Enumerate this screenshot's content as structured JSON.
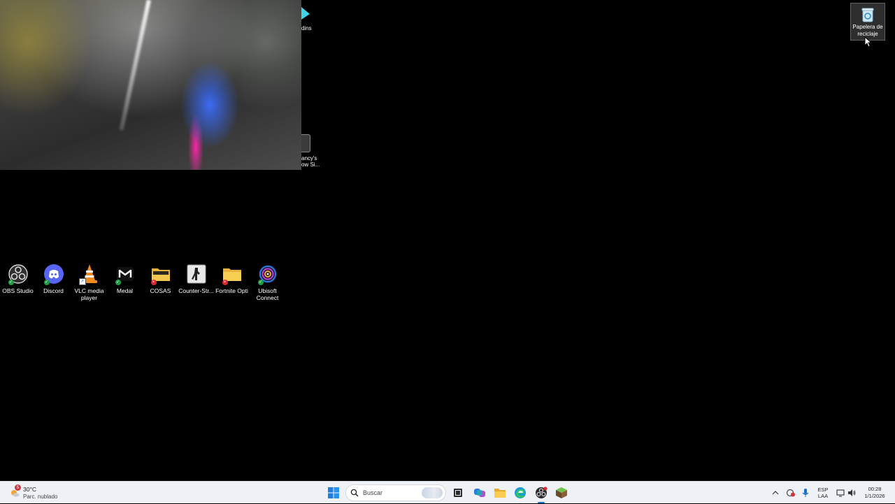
{
  "desktop": {
    "partial_icons": [
      {
        "label": "dins"
      },
      {
        "label_line1": "ancy's",
        "label_line2": "ow Si..."
      }
    ],
    "recycle_bin": {
      "label": "Papelera de reciclaje"
    },
    "icons": [
      {
        "label": "OBS Studio",
        "icon": "obs-icon",
        "status": "synced"
      },
      {
        "label": "Discord",
        "icon": "discord-icon",
        "status": "synced"
      },
      {
        "label": "VLC media player",
        "icon": "vlc-icon",
        "status": "shortcut"
      },
      {
        "label": "Medal",
        "icon": "medal-icon",
        "status": "synced"
      },
      {
        "label": "COSAS",
        "icon": "folder-icon",
        "status": "error"
      },
      {
        "label": "Counter-Str...",
        "icon": "counter-strike-icon",
        "status": "none"
      },
      {
        "label": "Fortnite Opti",
        "icon": "folder-icon",
        "status": "error"
      },
      {
        "label": "Ubisoft Connect",
        "icon": "ubisoft-icon",
        "status": "synced"
      }
    ]
  },
  "taskbar": {
    "weather": {
      "temp": "30°C",
      "condition": "Parc. nublado",
      "alert_count": "5"
    },
    "search": {
      "placeholder": "Buscar"
    },
    "pinned": [
      "start-icon",
      "task-view-icon",
      "copilot-icon",
      "file-explorer-icon",
      "edge-icon",
      "obs-icon",
      "minecraft-icon"
    ],
    "tray": {
      "language": "ESP",
      "layout": "LAA",
      "time": "00:28",
      "date": "1/1/2026"
    }
  },
  "colors": {
    "taskbar_bg": "#eef1f6",
    "desktop_bg": "#000000",
    "accent": "#0078d4"
  }
}
